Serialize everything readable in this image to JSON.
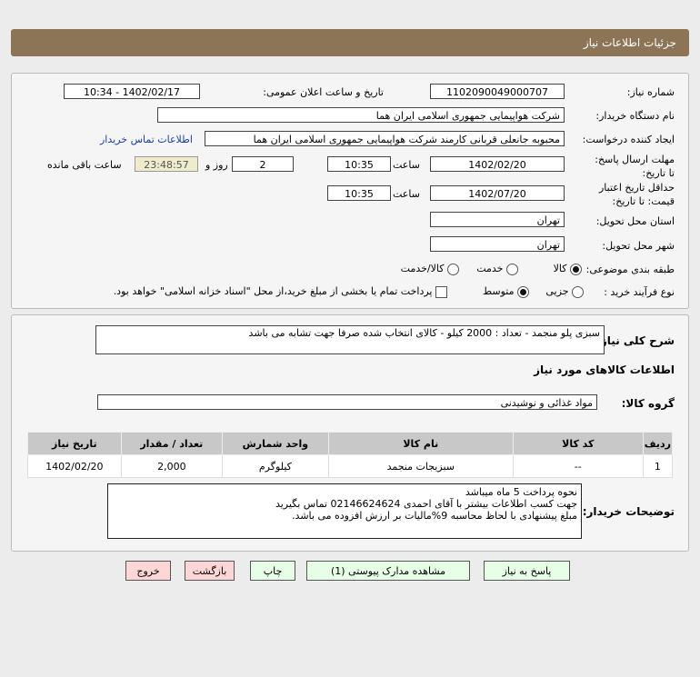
{
  "header": {
    "title": "جزئیات اطلاعات نیاز"
  },
  "form": {
    "need_number_label": "شماره نیاز:",
    "need_number": "1102090049000707",
    "announce_label": "تاریخ و ساعت اعلان عمومی:",
    "announce_value": "1402/02/17 - 10:34",
    "buyer_label": "نام دستگاه خریدار:",
    "buyer": "شرکت هواپیمایی جمهوری اسلامی ایران هما",
    "creator_label": "ایجاد کننده درخواست:",
    "creator": "محبوبه جانعلی قربانی کارمند شرکت هواپیمایی جمهوری اسلامی ایران هما",
    "contact_link": "اطلاعات تماس خریدار",
    "deadline_label": "مهلت ارسال پاسخ: تا تاریخ:",
    "deadline_date": "1402/02/20",
    "time_label": "ساعت",
    "deadline_time": "10:35",
    "days": "2",
    "days_label": "روز و",
    "remaining": "23:48:57",
    "remaining_label": "ساعت باقی مانده",
    "validity_label": "حداقل تاریخ اعتبار قیمت: تا تاریخ:",
    "validity_date": "1402/07/20",
    "validity_time": "10:35",
    "province_label": "استان محل تحویل:",
    "province": "تهران",
    "city_label": "شهر محل تحویل:",
    "city": "تهران",
    "category_label": "طبقه بندی موضوعی:",
    "category_options": [
      "کالا",
      "خدمت",
      "کالا/خدمت"
    ],
    "process_label": "نوع فرآیند خرید :",
    "process_options": [
      "جزیی",
      "متوسط"
    ],
    "treasury_note": "پرداخت تمام یا بخشی از مبلغ خرید،از محل \"اسناد خزانه اسلامی\" خواهد بود."
  },
  "details": {
    "summary_label": "شرح کلی نیاز:",
    "summary": "سبزی پلو منجمد - تعداد : 2000 کیلو - کالای انتخاب شده صرفا جهت تشابه می باشد",
    "goods_title": "اطلاعات کالاهای مورد نیاز",
    "group_label": "گروه کالا:",
    "group": "مواد غذائی و نوشیدنی",
    "table": {
      "headers": [
        "ردیف",
        "کد کالا",
        "نام کالا",
        "واحد شمارش",
        "تعداد / مقدار",
        "تاریخ نیاز"
      ],
      "rows": [
        [
          "1",
          "--",
          "سبزیجات منجمد",
          "کیلوگرم",
          "2,000",
          "1402/02/20"
        ]
      ]
    },
    "notes_label": "توضیحات خریدار:",
    "notes": [
      "نحوه پرداخت 5 ماه میباشد",
      "جهت کسب اطلاعات بیشتر با آقای احمدی 02146624624 تماس بگیرید",
      "مبلغ پیشنهادی با لحاظ محاسبه 9%مالیات بر ارزش افزوده می باشد."
    ]
  },
  "buttons": {
    "reply": "پاسخ به نیاز",
    "attachments": "مشاهده مدارک پیوستی (1)",
    "print": "چاپ",
    "back": "بازگشت",
    "exit": "خروج"
  }
}
